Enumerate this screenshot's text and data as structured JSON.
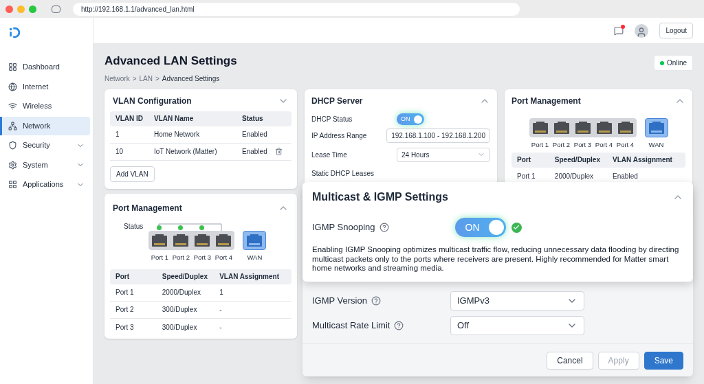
{
  "browser": {
    "url": "http://192.168.1.1/advanced_lan.html"
  },
  "sidebar": {
    "items": [
      {
        "label": "Dashboard",
        "selected": false,
        "expandable": false
      },
      {
        "label": "Internet",
        "selected": false,
        "expandable": false
      },
      {
        "label": "Wireless",
        "selected": false,
        "expandable": false
      },
      {
        "label": "Network",
        "selected": true,
        "expandable": false
      },
      {
        "label": "Security",
        "selected": false,
        "expandable": true
      },
      {
        "label": "System",
        "selected": false,
        "expandable": true
      },
      {
        "label": "Applications",
        "selected": false,
        "expandable": true
      }
    ]
  },
  "header": {
    "notification": true,
    "logout": "Logout"
  },
  "page": {
    "title": "Advanced LAN Settings",
    "breadcrumb": [
      "Network",
      "LAN",
      "Advanced Settings"
    ],
    "separator": ">",
    "status": "Online"
  },
  "vlan_card": {
    "title": "VLAN Configuration",
    "expanded": false,
    "columns": [
      "VLAN ID",
      "VLAN Name",
      "Status"
    ],
    "rows": [
      {
        "id": "1",
        "name": "Home Network",
        "status": "Enabled",
        "deletable": false
      },
      {
        "id": "10",
        "name": "IoT Network (Matter)",
        "status": "Enabled",
        "deletable": true
      }
    ],
    "add_button": "Add VLAN"
  },
  "port_card_left": {
    "title": "Port Management",
    "expanded": true,
    "status_label": "Status",
    "ports": [
      {
        "label": "Port 1",
        "kind": "lan",
        "link": true
      },
      {
        "label": "Port 2",
        "kind": "lan",
        "link": true
      },
      {
        "label": "Port 3",
        "kind": "lan",
        "link": true
      },
      {
        "label": "Port 4",
        "kind": "lan",
        "link": false
      },
      {
        "label": "WAN",
        "kind": "wan",
        "link": false
      }
    ],
    "columns": [
      "Port",
      "Speed/Duplex",
      "VLAN Assignment"
    ],
    "rows": [
      [
        "Port 1",
        "2000/Duplex",
        "1"
      ],
      [
        "Port 2",
        "300/Duplex",
        "-"
      ],
      [
        "Port 3",
        "300/Duplex",
        "-"
      ]
    ]
  },
  "dhcp_card": {
    "title": "DHCP Server",
    "expanded": true,
    "status_label": "DHCP Status",
    "status_toggle": {
      "label": "ON",
      "on": true
    },
    "range_label": "IP Address Range",
    "range_value": "192.168.1.100 - 192.168.1.200",
    "lease_label": "Lease Time",
    "lease_value": "24 Hours",
    "static_label": "Static DHCP Leases"
  },
  "port_card_right": {
    "title": "Port Management",
    "expanded": true,
    "ports": [
      {
        "label": "Port 1",
        "kind": "lan"
      },
      {
        "label": "Port 2",
        "kind": "lan"
      },
      {
        "label": "Port 3",
        "kind": "lan"
      },
      {
        "label": "Port 4",
        "kind": "lan"
      },
      {
        "label": "Port 4",
        "kind": "lan"
      },
      {
        "label": "WAN",
        "kind": "wan"
      }
    ],
    "columns": [
      "Port",
      "Speed/Duplex",
      "VLAN Assignment"
    ],
    "rows": [
      [
        "Port 1",
        "2000/Duplex",
        "Enabled"
      ]
    ]
  },
  "multicast": {
    "title": "Multicast & IGMP Settings",
    "expanded": true,
    "snooping_label": "IGMP Snooping",
    "snooping_toggle": {
      "label": "ON",
      "on": true
    },
    "description": "Enabling IGMP Snooping optimizes multicast traffic flow, reducing unnecessary data flooding by directing multicast packets only to the ports where receivers are present. Highly recommended for Matter smart home networks and streaming media.",
    "version_label": "IGMP Version",
    "version_value": "IGMPv3",
    "rate_label": "Multicast Rate Limit",
    "rate_value": "Off",
    "buttons": [
      {
        "label": "Cancel",
        "kind": "secondary",
        "disabled": false
      },
      {
        "label": "Apply",
        "kind": "secondary",
        "disabled": true
      },
      {
        "label": "Save",
        "kind": "primary",
        "disabled": false
      }
    ]
  }
}
